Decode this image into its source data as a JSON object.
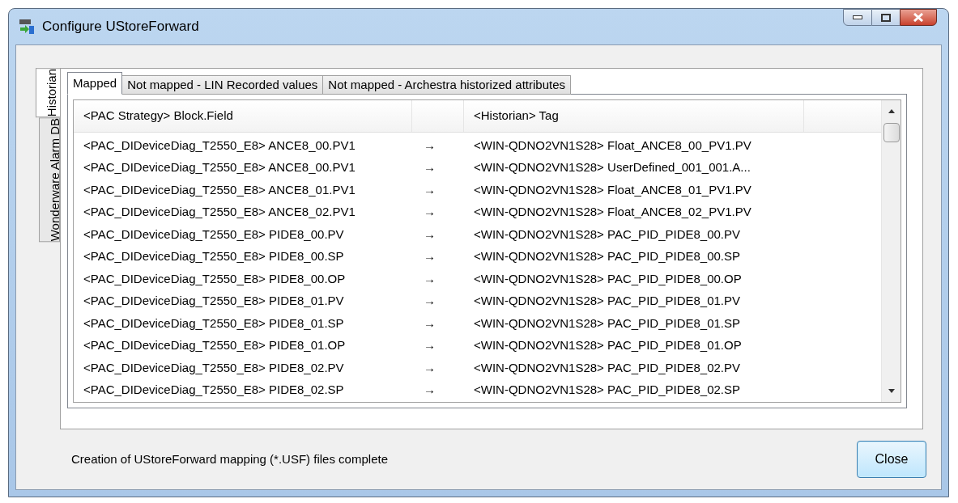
{
  "window": {
    "title": "Configure UStoreForward"
  },
  "side_tabs": [
    {
      "label": "Historian",
      "selected": true
    },
    {
      "label": "Wonderware Alarm DB",
      "selected": false
    }
  ],
  "tabs": [
    {
      "label": "Mapped",
      "selected": true
    },
    {
      "label": "Not mapped - LIN Recorded values",
      "selected": false
    },
    {
      "label": "Not mapped - Archestra historized attributes",
      "selected": false
    }
  ],
  "table": {
    "columns": [
      "<PAC Strategy> Block.Field",
      "<Historian> Tag"
    ],
    "rows": [
      {
        "source": "<PAC_DIDeviceDiag_T2550_E8> ANCE8_00.PV1",
        "arrow": "→",
        "target": "<WIN-QDNO2VN1S28> Float_ANCE8_00_PV1.PV"
      },
      {
        "source": "<PAC_DIDeviceDiag_T2550_E8> ANCE8_00.PV1",
        "arrow": "→",
        "target": "<WIN-QDNO2VN1S28> UserDefined_001_001.A..."
      },
      {
        "source": "<PAC_DIDeviceDiag_T2550_E8> ANCE8_01.PV1",
        "arrow": "→",
        "target": "<WIN-QDNO2VN1S28> Float_ANCE8_01_PV1.PV"
      },
      {
        "source": "<PAC_DIDeviceDiag_T2550_E8> ANCE8_02.PV1",
        "arrow": "→",
        "target": "<WIN-QDNO2VN1S28> Float_ANCE8_02_PV1.PV"
      },
      {
        "source": "<PAC_DIDeviceDiag_T2550_E8> PIDE8_00.PV",
        "arrow": "→",
        "target": "<WIN-QDNO2VN1S28> PAC_PID_PIDE8_00.PV"
      },
      {
        "source": "<PAC_DIDeviceDiag_T2550_E8> PIDE8_00.SP",
        "arrow": "→",
        "target": "<WIN-QDNO2VN1S28> PAC_PID_PIDE8_00.SP"
      },
      {
        "source": "<PAC_DIDeviceDiag_T2550_E8> PIDE8_00.OP",
        "arrow": "→",
        "target": "<WIN-QDNO2VN1S28> PAC_PID_PIDE8_00.OP"
      },
      {
        "source": "<PAC_DIDeviceDiag_T2550_E8> PIDE8_01.PV",
        "arrow": "→",
        "target": "<WIN-QDNO2VN1S28> PAC_PID_PIDE8_01.PV"
      },
      {
        "source": "<PAC_DIDeviceDiag_T2550_E8> PIDE8_01.SP",
        "arrow": "→",
        "target": "<WIN-QDNO2VN1S28> PAC_PID_PIDE8_01.SP"
      },
      {
        "source": "<PAC_DIDeviceDiag_T2550_E8> PIDE8_01.OP",
        "arrow": "→",
        "target": "<WIN-QDNO2VN1S28> PAC_PID_PIDE8_01.OP"
      },
      {
        "source": "<PAC_DIDeviceDiag_T2550_E8> PIDE8_02.PV",
        "arrow": "→",
        "target": "<WIN-QDNO2VN1S28> PAC_PID_PIDE8_02.PV"
      },
      {
        "source": "<PAC_DIDeviceDiag_T2550_E8> PIDE8_02.SP",
        "arrow": "→",
        "target": "<WIN-QDNO2VN1S28> PAC_PID_PIDE8_02.SP"
      }
    ]
  },
  "status": "Creation of UStoreForward mapping (*.USF) files complete",
  "buttons": [
    "Close"
  ]
}
